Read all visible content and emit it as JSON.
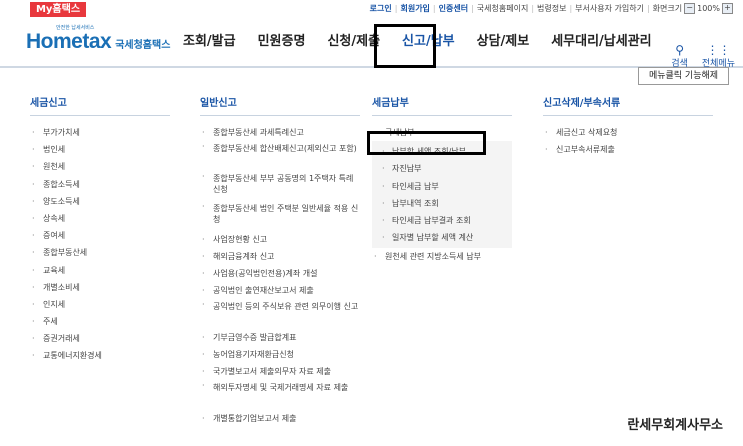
{
  "topbar": {
    "my_tab": "My홈택스",
    "links": [
      "로그인",
      "회원가입",
      "인증센터",
      "국세청홈페이지",
      "법령정보",
      "부서사용자 가입하기",
      "화면크기"
    ],
    "zoom_minus": "−",
    "zoom_value": "100%",
    "zoom_plus": "+"
  },
  "header": {
    "logo_main": "Hometax",
    "logo_sub": "국세청홈택스",
    "logo_tiny": "안전한 납세서비스",
    "nav": [
      "조회/발급",
      "민원증명",
      "신청/제출",
      "신고/납부",
      "상담/제보",
      "세무대리/납세관리"
    ],
    "active_nav": "신고/납부",
    "search_label": "검색",
    "menu_label": "전체메뉴"
  },
  "menu_button": "메뉴클릭 기능해제",
  "columns": {
    "tax_report": {
      "title": "세금신고",
      "items": [
        "부가가치세",
        "법인세",
        "원천세",
        "종합소득세",
        "양도소득세",
        "상속세",
        "증여세",
        "종합부동산세",
        "교육세",
        "개별소비세",
        "인지세",
        "주세",
        "증권거래세",
        "교통에너지환경세"
      ]
    },
    "general_report": {
      "title": "일반신고",
      "items": [
        "종합부동산세 과세특례신고",
        "종합부동산세 합산배제신고(제외신고 포함)",
        "종합부동산세 부부 공동명의 1주택자 특례 신청",
        "종합부동산세 법인 주택분 일반세율 적용 신청",
        "사업장현황 신고",
        "해외금융계좌 신고",
        "사업용(공익법인전용)계좌 개설",
        "공익법인 출연재산보고서 제출",
        "공익법인 등의 주식보유 관련 의무이행 신고",
        "기부금영수증 발급합계표",
        "농어업용기자재환급신청",
        "국가별보고서 제출의무자 자료 제출",
        "해외투자명세 및 국제거래명세 자료 제출",
        "개별통합기업보고서 제출"
      ]
    },
    "tax_payment": {
      "title": "세금납부",
      "group": "국세납부",
      "sub_items": [
        "납부할 세액 조회/납부",
        "자진납부",
        "타인세금 납부",
        "납부내역 조회",
        "타인세금 납부결과 조회",
        "일자별 납부할 세액 계산"
      ],
      "extra": "원천세 관련 지방소득세 납부"
    },
    "delete_docs": {
      "title": "신고삭제/부속서류",
      "items": [
        "세금신고 삭제요청",
        "신고부속서류제출"
      ]
    }
  },
  "footer_text": "란세무회계사무소"
}
